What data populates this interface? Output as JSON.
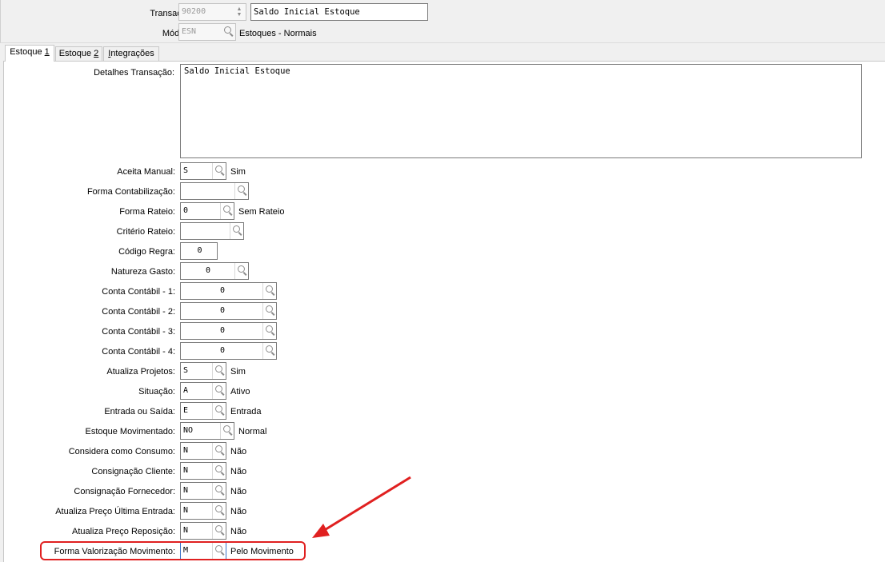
{
  "header": {
    "transacao_label": "Transação:",
    "transacao_code": "90200",
    "transacao_desc": "Saldo Inicial Estoque",
    "modulo_label": "Módulo:",
    "modulo_code": "ESN",
    "modulo_desc": "Estoques - Normais"
  },
  "tabs": [
    {
      "pre": "Estoque ",
      "key": "1",
      "post": ""
    },
    {
      "pre": "Estoque ",
      "key": "2",
      "post": ""
    },
    {
      "pre": "",
      "key": "I",
      "post": "ntegrações"
    }
  ],
  "details": {
    "label": "Detalhes Transação:",
    "value": "Saldo Inicial Estoque"
  },
  "fields": [
    {
      "label": "Aceita Manual:",
      "value": "S",
      "desc": "Sim"
    },
    {
      "label": "Forma Contabilização:",
      "value": "",
      "desc": ""
    },
    {
      "label": "Forma Rateio:",
      "value": "0",
      "desc": "Sem Rateio"
    },
    {
      "label": "Critério Rateio:",
      "value": "",
      "desc": ""
    },
    {
      "label": "Código Regra:",
      "value": "0",
      "desc": ""
    },
    {
      "label": "Natureza Gasto:",
      "value": "0",
      "desc": ""
    },
    {
      "label": "Conta Contábil - 1:",
      "value": "0",
      "desc": ""
    },
    {
      "label": "Conta Contábil - 2:",
      "value": "0",
      "desc": ""
    },
    {
      "label": "Conta Contábil - 3:",
      "value": "0",
      "desc": ""
    },
    {
      "label": "Conta Contábil - 4:",
      "value": "0",
      "desc": ""
    },
    {
      "label": "Atualiza Projetos:",
      "value": "S",
      "desc": "Sim"
    },
    {
      "label": "Situação:",
      "value": "A",
      "desc": "Ativo"
    },
    {
      "label": "Entrada ou Saída:",
      "value": "E",
      "desc": "Entrada"
    },
    {
      "label": "Estoque Movimentado:",
      "value": "NO",
      "desc": "Normal"
    },
    {
      "label": "Considera como Consumo:",
      "value": "N",
      "desc": "Não"
    },
    {
      "label": "Consignação Cliente:",
      "value": "N",
      "desc": "Não"
    },
    {
      "label": "Consignação Fornecedor:",
      "value": "N",
      "desc": "Não"
    },
    {
      "label": "Atualiza Preço Última Entrada:",
      "value": "N",
      "desc": "Não"
    },
    {
      "label": "Atualiza Preço Reposição:",
      "value": "N",
      "desc": "Não"
    },
    {
      "label": "Forma Valorização Movimento:",
      "value": "M",
      "desc": "Pelo Movimento"
    }
  ],
  "colors": {
    "highlight": "#e02020",
    "arrow": "#e02020"
  }
}
